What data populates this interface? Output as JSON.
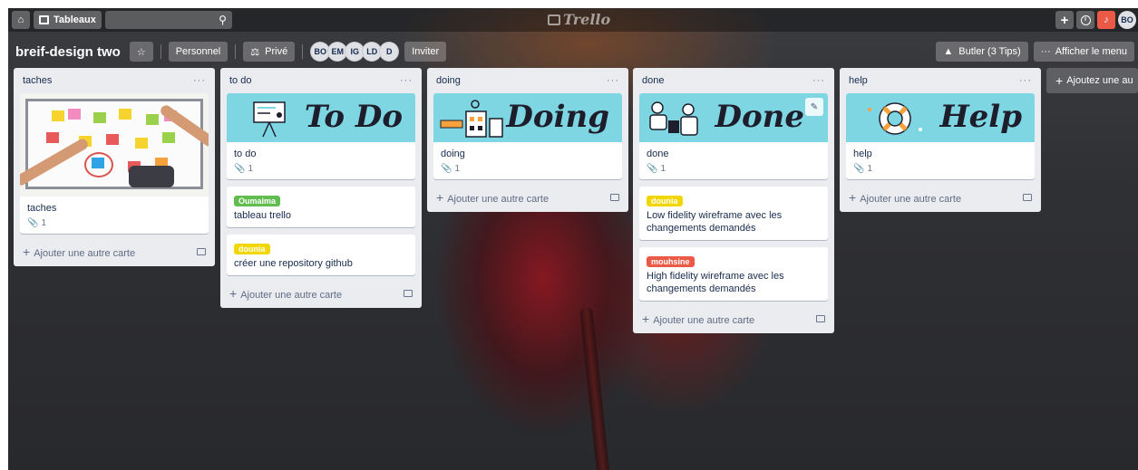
{
  "header": {
    "home_label": "⌂",
    "boards_label": "Tableaux",
    "search_placeholder": "",
    "logo": "Trello",
    "avatar": "BO"
  },
  "board": {
    "title": "breif-design two",
    "personal_label": "Personnel",
    "privacy_label": "Privé",
    "members": [
      "BO",
      "EM",
      "IG",
      "LD",
      "D"
    ],
    "invite_label": "Inviter",
    "butler_label": "Butler (3 Tips)",
    "menu_label": "Afficher le menu"
  },
  "colors": {
    "label_green": "#61bd4f",
    "label_yellow": "#f2d600",
    "label_red": "#eb5a46",
    "cover_cyan": "#7fd6e3"
  },
  "lists": [
    {
      "title": "taches",
      "cards": [
        {
          "title": "taches",
          "attachments": "1"
        }
      ],
      "add_label": "Ajouter une autre carte"
    },
    {
      "title": "to do",
      "cover_text": "To Do",
      "cards": [
        {
          "title": "to do",
          "attachments": "1"
        },
        {
          "label": "Oumaima",
          "title": "tableau trello"
        },
        {
          "label": "dounia",
          "title": "créer une repository github"
        }
      ],
      "add_label": "Ajouter une autre carte"
    },
    {
      "title": "doing",
      "cover_text": "Doing",
      "cards": [
        {
          "title": "doing",
          "attachments": "1"
        }
      ],
      "add_label": "Ajouter une autre carte"
    },
    {
      "title": "done",
      "cover_text": "Done",
      "cards": [
        {
          "title": "done",
          "attachments": "1"
        },
        {
          "label": "dounia",
          "title": "Low fidelity wireframe avec les changements demandés"
        },
        {
          "label": "mouhsine",
          "title": "High fidelity wireframe avec les changements demandés"
        }
      ],
      "add_label": "Ajouter une autre carte"
    },
    {
      "title": "help",
      "cover_text": "Help",
      "cards": [
        {
          "title": "help",
          "attachments": "1"
        }
      ],
      "add_label": "Ajouter une autre carte"
    }
  ],
  "add_list_label": "Ajoutez une au",
  "list_menu": "···"
}
